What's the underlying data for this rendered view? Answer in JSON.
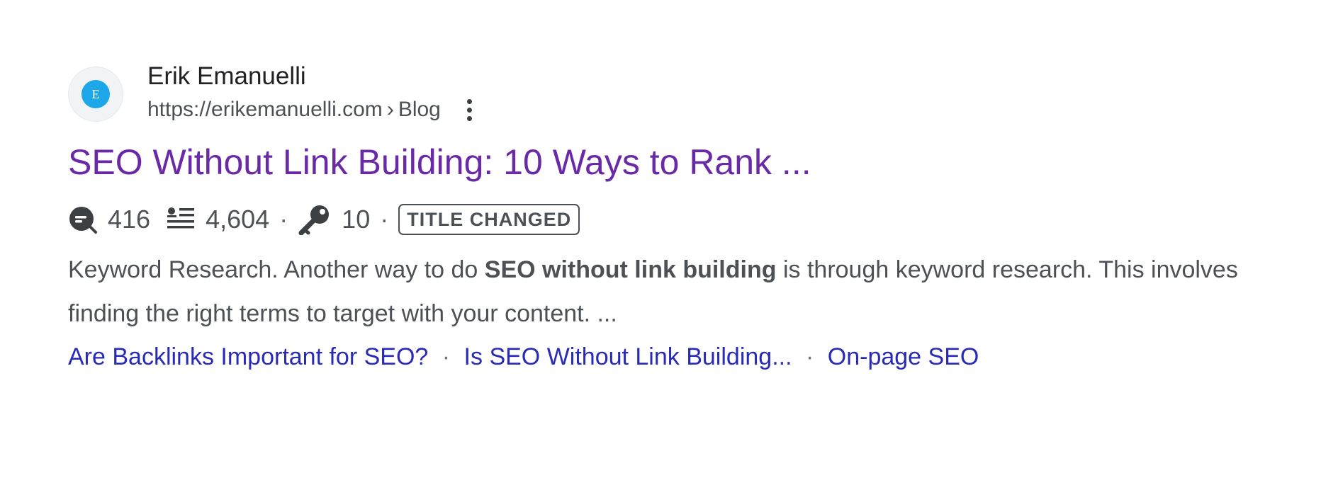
{
  "result": {
    "favicon_letter": "E",
    "site_name": "Erik Emanuelli",
    "site_url": "https://erikemanuelli.com",
    "breadcrumb_separator": "›",
    "breadcrumb": "Blog",
    "more_options_icon": "more-vert-icon",
    "title": "SEO Without Link Building: 10 Ways to Rank ...",
    "metrics": {
      "metric_1_icon": "search-chat-icon",
      "metric_1_value": "416",
      "metric_2_icon": "list-lines-icon",
      "metric_2_value": "4,604",
      "metric_3_icon": "key-icon",
      "metric_3_value": "10",
      "separator": "·",
      "badge": "TITLE CHANGED"
    },
    "snippet": {
      "before": "Keyword Research. Another way to do ",
      "bold": "SEO without link building",
      "after": " is through keyword research. This involves finding the right terms to target with your content. ..."
    },
    "sitelinks": [
      {
        "label": "Are Backlinks Important for SEO?"
      },
      {
        "label": "Is SEO Without Link Building..."
      },
      {
        "label": "On-page SEO"
      }
    ],
    "sitelink_separator": "·"
  },
  "colors": {
    "title_visited": "#6a2aa6",
    "sitelink": "#2a2ab8",
    "text": "#4d5156",
    "favicon": "#1ea7e8"
  }
}
